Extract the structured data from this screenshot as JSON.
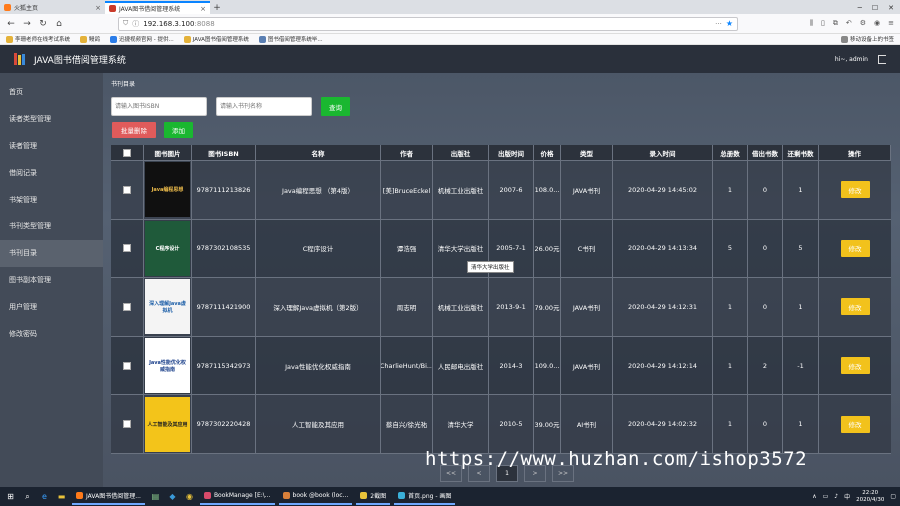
{
  "browser": {
    "tabs": [
      {
        "label": "火狐主页"
      },
      {
        "label": "JAVA图书借阅管理系统"
      }
    ],
    "url_host": "192.168.3.100",
    "url_port": ":8088",
    "bookmarks": [
      "李珊老师在线考试系统",
      "鳗鸽",
      "迅捷视频官网 - 提供...",
      "JAVA图书借阅管理系统",
      "图书借阅管理系统毕..."
    ],
    "mobile_bookmarks": "移动设备上的书签"
  },
  "app": {
    "title": "JAVA图书借阅管理系统",
    "user": "hi~, admin"
  },
  "sidebar": {
    "items": [
      {
        "label": "首页"
      },
      {
        "label": "读者类型管理"
      },
      {
        "label": "读者管理"
      },
      {
        "label": "借阅记录"
      },
      {
        "label": "书架管理"
      },
      {
        "label": "书刊类型管理"
      },
      {
        "label": "书刊目录"
      },
      {
        "label": "图书副本管理"
      },
      {
        "label": "用户管理"
      },
      {
        "label": "修改密码"
      }
    ],
    "active_index": 6
  },
  "main": {
    "breadcrumb": "书刊目录",
    "search_isbn_placeholder": "请输入图书ISBN",
    "search_name_placeholder": "请输入书刊名称",
    "search_label": "查询",
    "batch_delete_label": "批量删除",
    "add_label": "添加",
    "edit_label": "修改",
    "tooltip": "清华大学出版社",
    "table": {
      "headers": [
        "",
        "图书图片",
        "图书ISBN",
        "名称",
        "作者",
        "出版社",
        "出版时间",
        "价格",
        "类型",
        "录入时间",
        "总册数",
        "借出书数",
        "还剩书数",
        "操作"
      ],
      "rows": [
        {
          "isbn": "9787111213826",
          "name": "Java编程思想 （第4版）",
          "author": "[美]BruceEckel",
          "publisher": "机械工业出版社",
          "date": "2007-6",
          "price": "108.0...",
          "type": "JAVA书刊",
          "created": "2020-04-29 14:45:02",
          "total": "1",
          "lent": "0",
          "left": "1",
          "cover_text": "Java编程思想",
          "cover_color": "#101010",
          "cover_fg": "#e8b84a"
        },
        {
          "isbn": "9787302108535",
          "name": "C程序设计",
          "author": "谭浩强",
          "publisher": "清华大学出版社",
          "date": "2005-7-1",
          "price": "26.00元",
          "type": "C书刊",
          "created": "2020-04-29 14:13:34",
          "total": "5",
          "lent": "0",
          "left": "5",
          "cover_text": "C程序设计",
          "cover_color": "#1f5a3a",
          "cover_fg": "#ffffff"
        },
        {
          "isbn": "9787111421900",
          "name": "深入理解Java虚拟机（第2版）",
          "author": "周志明",
          "publisher": "机械工业出版社",
          "date": "2013-9-1",
          "price": "79.00元",
          "type": "JAVA书刊",
          "created": "2020-04-29 14:12:31",
          "total": "1",
          "lent": "0",
          "left": "1",
          "cover_text": "深入理解Java虚拟机",
          "cover_color": "#f4f4f4",
          "cover_fg": "#1d5fa8"
        },
        {
          "isbn": "9787115342973",
          "name": "Java性能优化权威指南",
          "author": "CharlieHunt/Bi...",
          "publisher": "人民邮电出版社",
          "date": "2014-3",
          "price": "109.0...",
          "type": "JAVA书刊",
          "created": "2020-04-29 14:12:14",
          "total": "1",
          "lent": "2",
          "left": "-1",
          "cover_text": "Java性能优化权威指南",
          "cover_color": "#ffffff",
          "cover_fg": "#1a3f8a"
        },
        {
          "isbn": "9787302220428",
          "name": "人工智能及其应用",
          "author": "蔡自兴/徐光祐",
          "publisher": "清华大学",
          "date": "2010-5",
          "price": "39.00元",
          "type": "AI书刊",
          "created": "2020-04-29 14:02:32",
          "total": "1",
          "lent": "0",
          "left": "1",
          "cover_text": "人工智能及其应用",
          "cover_color": "#f3c41a",
          "cover_fg": "#222222"
        }
      ]
    },
    "pager": {
      "prev2": "<<",
      "prev": "<",
      "current": "1",
      "next": ">",
      "next2": ">>"
    }
  },
  "watermark": "https://www.huzhan.com/ishop3572",
  "taskbar": {
    "apps": [
      {
        "label": "JAVA图书借阅管理..."
      },
      {
        "label": "BookManage [E:\\..."
      },
      {
        "label": "book @book (loc..."
      },
      {
        "label": "2截图"
      },
      {
        "label": "首页.png - 画图"
      }
    ],
    "ime": "中",
    "time": "22:20",
    "date": "2020/4/30"
  }
}
